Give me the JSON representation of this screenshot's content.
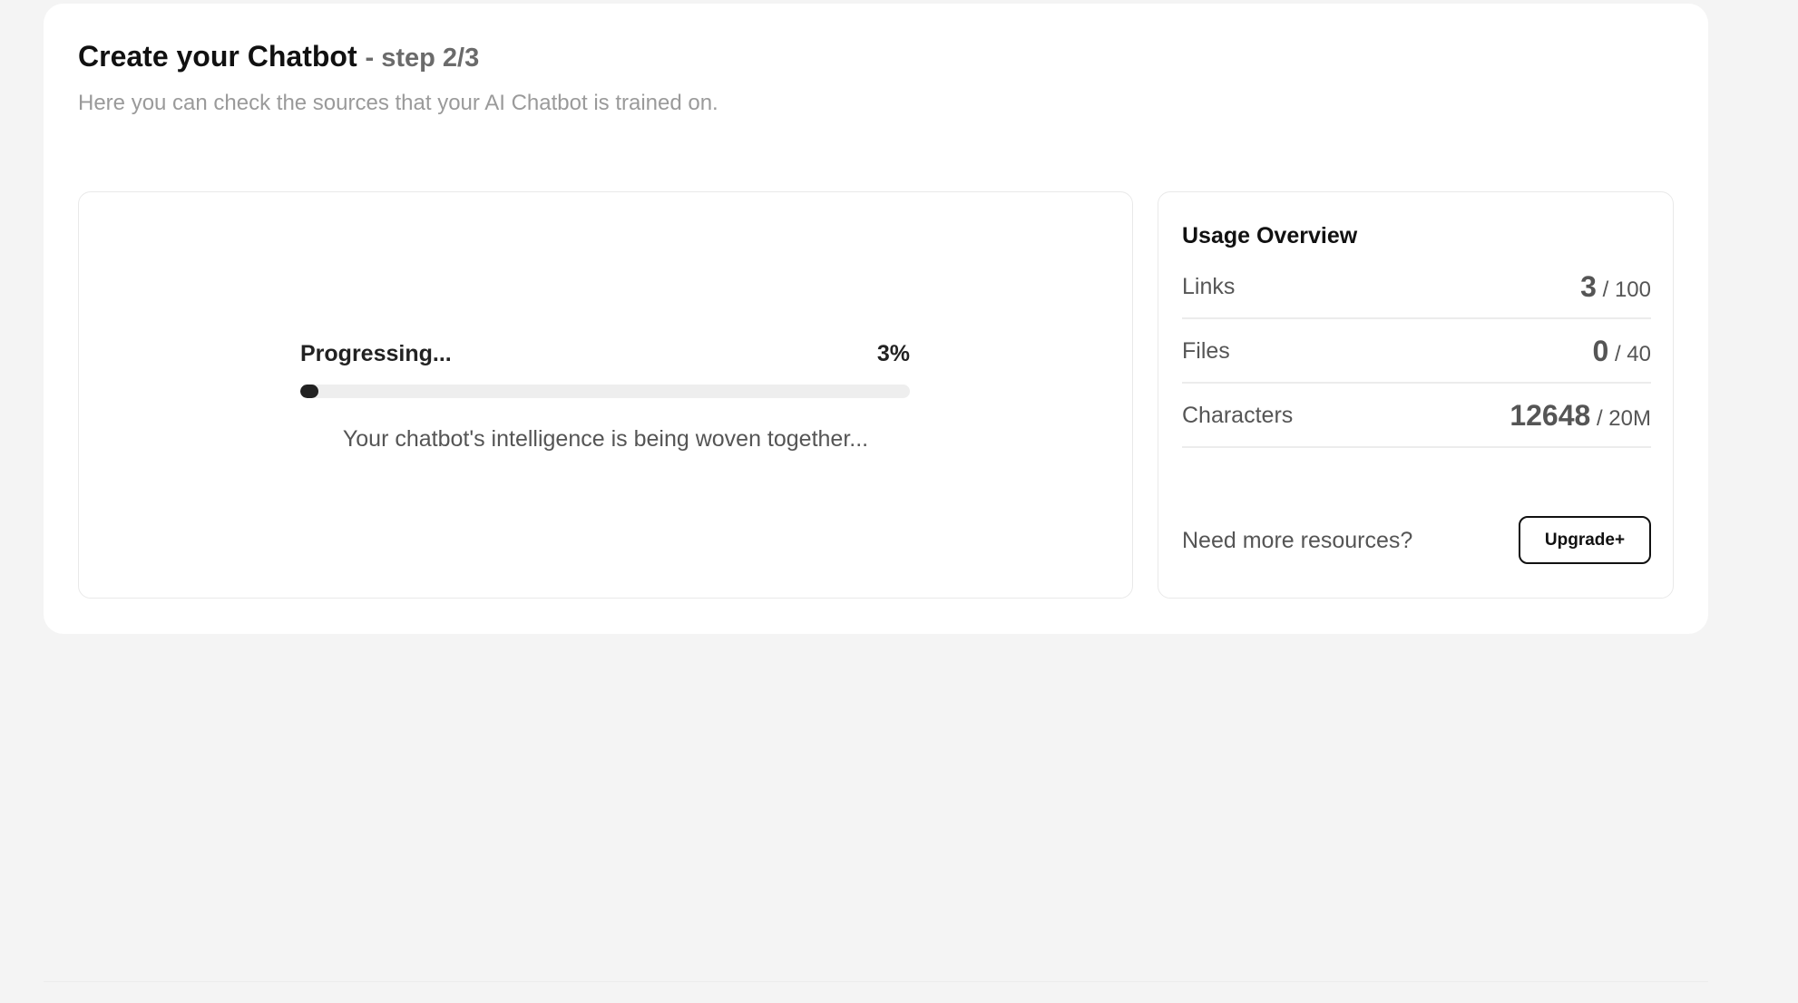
{
  "header": {
    "title": "Create your Chatbot",
    "step": "- step 2/3",
    "subtitle": "Here you can check the sources that your AI Chatbot is trained on."
  },
  "progress": {
    "label": "Progressing...",
    "percent_text": "3%",
    "percent": 3,
    "message": "Your chatbot's intelligence is being woven together..."
  },
  "usage": {
    "title": "Usage Overview",
    "rows": [
      {
        "label": "Links",
        "used": "3",
        "limit": "/ 100"
      },
      {
        "label": "Files",
        "used": "0",
        "limit": "/ 40"
      },
      {
        "label": "Characters",
        "used": "12648",
        "limit": "/ 20M"
      }
    ],
    "need_more": "Need more resources?",
    "upgrade_label": "Upgrade+"
  }
}
